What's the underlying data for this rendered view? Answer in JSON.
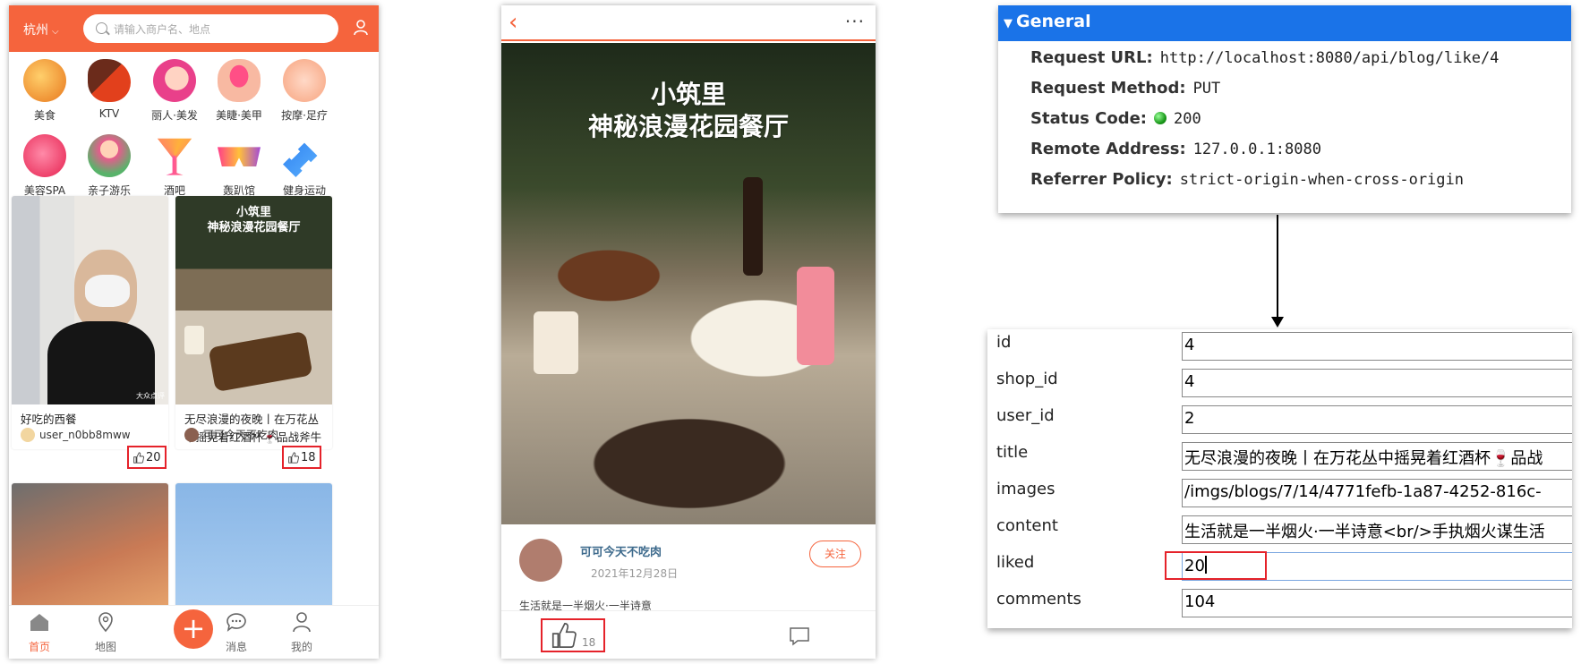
{
  "phone1": {
    "city": "杭州",
    "search_placeholder": "请输入商户名、地点",
    "categories": [
      "美食",
      "KTV",
      "丽人·美发",
      "美睫·美甲",
      "按摩·足疗",
      "美容SPA",
      "亲子游乐",
      "酒吧",
      "轰趴馆",
      "健身运动"
    ],
    "cards": [
      {
        "title": "好吃的西餐",
        "author": "user_n0bb8mww",
        "likes": "20"
      },
      {
        "title": "无尽浪漫的夜晚丨在万花丛中摇晃着红酒杯🍷品战斧牛排",
        "author": "可可今天不吃肉",
        "likes": "18"
      }
    ],
    "card1_image_caption": "大众点评",
    "card2_image_title": [
      "小筑里",
      "神秘浪漫花园餐厅"
    ],
    "tabs": [
      "首页",
      "地图",
      "消息",
      "我的"
    ],
    "plus": "+"
  },
  "phone2": {
    "image_title": [
      "小筑里",
      "神秘浪漫花园餐厅"
    ],
    "author": "可可今天不吃肉",
    "date": "2021年12月28日",
    "follow": "关注",
    "snippet": "生活就是一半烟火·一半诗意",
    "likes": "18"
  },
  "devtools": {
    "section": "General",
    "rows": [
      {
        "key": "Request URL:",
        "value": "http://localhost:8080/api/blog/like/4"
      },
      {
        "key": "Request Method:",
        "value": "PUT"
      },
      {
        "key": "Status Code:",
        "value": "200"
      },
      {
        "key": "Remote Address:",
        "value": "127.0.0.1:8080"
      },
      {
        "key": "Referrer Policy:",
        "value": "strict-origin-when-cross-origin"
      }
    ]
  },
  "db_record": {
    "rows": [
      {
        "key": "id",
        "value": "4"
      },
      {
        "key": "shop_id",
        "value": "4"
      },
      {
        "key": "user_id",
        "value": "2"
      },
      {
        "key": "title",
        "value": "无尽浪漫的夜晚丨在万花丛中摇晃着红酒杯🍷品战"
      },
      {
        "key": "images",
        "value": "/imgs/blogs/7/14/4771fefb-1a87-4252-816c-"
      },
      {
        "key": "content",
        "value": "生活就是一半烟火·一半诗意<br/>手执烟火谋生活"
      },
      {
        "key": "liked",
        "value": "20"
      },
      {
        "key": "comments",
        "value": "104"
      }
    ]
  },
  "colors": {
    "brand": "#f5643d",
    "highlight": "#e5222a",
    "devtools_blue": "#1a73e8"
  }
}
